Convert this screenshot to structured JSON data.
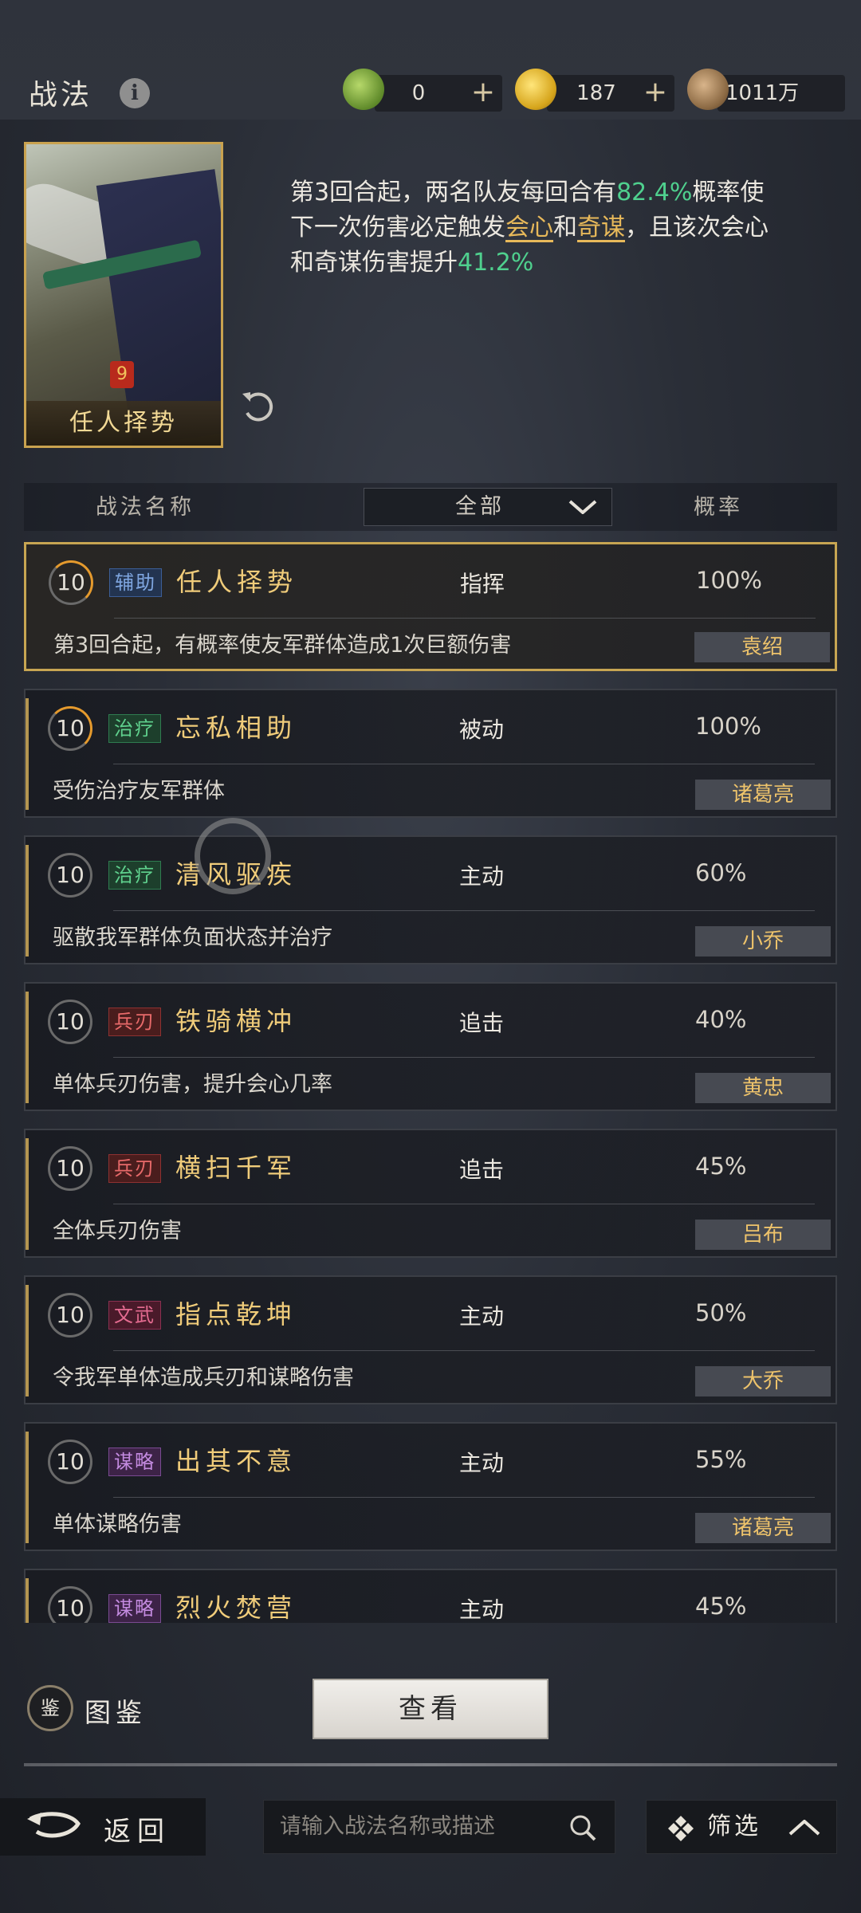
{
  "header": {
    "title": "战法",
    "resources": [
      {
        "icon": "jade-coin-icon",
        "value": "0",
        "has_plus": true
      },
      {
        "icon": "gold-coin-icon",
        "value": "187",
        "has_plus": true
      },
      {
        "icon": "copper-coin-icon",
        "value": "1011万",
        "has_plus": false
      }
    ]
  },
  "featured": {
    "card_name": "任人择势",
    "card_badge": "9",
    "desc_parts": [
      "第3回合起，两名队友每回合有",
      "82.4%",
      "概率使下一次伤害必定触发",
      "会心",
      "和",
      "奇谋",
      "，且该次会心和奇谋伤害提升",
      "41.2%"
    ]
  },
  "columns": {
    "name": "战法名称",
    "filter": "全部",
    "rate": "概率"
  },
  "tactics": [
    {
      "level": "10",
      "tag": "辅助",
      "tag_class": "tag-assist",
      "name": "任人择势",
      "type": "指挥",
      "rate": "100%",
      "desc": "第3回合起，有概率使友军群体造成1次巨额伤害",
      "owner": "袁绍",
      "selected": true,
      "progress": true
    },
    {
      "level": "10",
      "tag": "治疗",
      "tag_class": "tag-heal",
      "name": "忘私相助",
      "type": "被动",
      "rate": "100%",
      "desc": "受伤治疗友军群体",
      "owner": "诸葛亮",
      "selected": false,
      "progress": true
    },
    {
      "level": "10",
      "tag": "治疗",
      "tag_class": "tag-heal",
      "name": "清风驱疾",
      "type": "主动",
      "rate": "60%",
      "desc": "驱散我军群体负面状态并治疗",
      "owner": "小乔",
      "selected": false,
      "progress": false
    },
    {
      "level": "10",
      "tag": "兵刃",
      "tag_class": "tag-blade",
      "name": "铁骑横冲",
      "type": "追击",
      "rate": "40%",
      "desc": "单体兵刃伤害，提升会心几率",
      "owner": "黄忠",
      "selected": false,
      "progress": false
    },
    {
      "level": "10",
      "tag": "兵刃",
      "tag_class": "tag-blade",
      "name": "横扫千军",
      "type": "追击",
      "rate": "45%",
      "desc": "全体兵刃伤害",
      "owner": "吕布",
      "selected": false,
      "progress": false
    },
    {
      "level": "10",
      "tag": "文武",
      "tag_class": "tag-civmil",
      "name": "指点乾坤",
      "type": "主动",
      "rate": "50%",
      "desc": "令我军单体造成兵刃和谋略伤害",
      "owner": "大乔",
      "selected": false,
      "progress": false
    },
    {
      "level": "10",
      "tag": "谋略",
      "tag_class": "tag-strat",
      "name": "出其不意",
      "type": "主动",
      "rate": "55%",
      "desc": "单体谋略伤害",
      "owner": "诸葛亮",
      "selected": false,
      "progress": false
    },
    {
      "level": "10",
      "tag": "谋略",
      "tag_class": "tag-strat",
      "name": "烈火焚营",
      "type": "主动",
      "rate": "45%",
      "desc": "",
      "owner": "",
      "selected": false,
      "progress": false
    }
  ],
  "bottom": {
    "atlas_icon_text": "鉴",
    "atlas_label": "图鉴",
    "view_button": "查看",
    "back_label": "返回",
    "search_placeholder": "请输入战法名称或描述",
    "filter_label": "筛选"
  }
}
